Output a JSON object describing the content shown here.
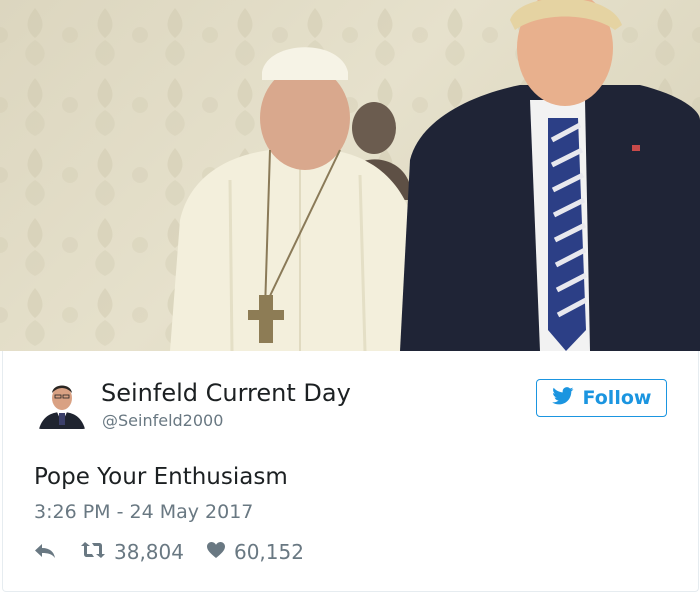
{
  "tweet": {
    "display_name": "Seinfeld Current Day",
    "handle": "@Seinfeld2000",
    "follow_label": "Follow",
    "text": "Pope Your Enthusiasm",
    "timestamp": "3:26 PM - 24 May 2017",
    "retweets": "38,804",
    "likes": "60,152"
  },
  "icons": {
    "reply": "reply-icon",
    "retweet": "retweet-icon",
    "like": "heart-icon",
    "twitter": "twitter-bird-icon"
  },
  "colors": {
    "accent": "#1b95e0",
    "text": "#1c2022",
    "muted": "#697882"
  }
}
